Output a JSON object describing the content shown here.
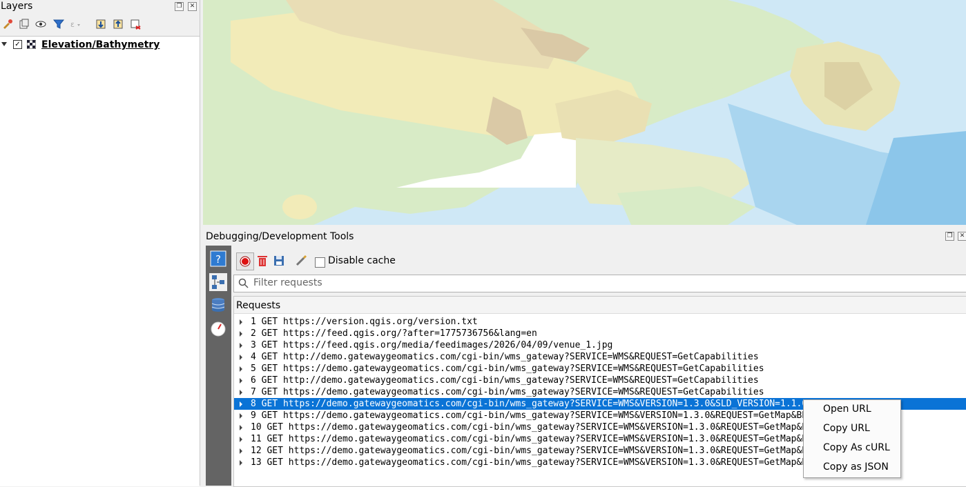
{
  "layers_panel": {
    "title": "Layers",
    "toolbar_icons": [
      "open-layer-styling-icon",
      "add-group-icon",
      "manage-map-themes-icon",
      "filter-legend-icon",
      "filter-by-expression-icon",
      "expand-all-icon",
      "collapse-all-icon",
      "remove-layer-icon"
    ],
    "layer": {
      "name": "Elevation/Bathymetry",
      "checked": true
    }
  },
  "debug_panel": {
    "title": "Debugging/Development Tools",
    "toolbar": {
      "disable_cache_label": "Disable cache"
    },
    "filter_placeholder": "Filter requests",
    "requests_header": "Requests",
    "requests": [
      "1 GET https://version.qgis.org/version.txt",
      "2 GET https://feed.qgis.org/?after=1775736756&lang=en",
      "3 GET https://feed.qgis.org/media/feedimages/2026/04/09/venue_1.jpg",
      "4 GET http://demo.gatewaygeomatics.com/cgi-bin/wms_gateway?SERVICE=WMS&REQUEST=GetCapabilities",
      "5 GET https://demo.gatewaygeomatics.com/cgi-bin/wms_gateway?SERVICE=WMS&REQUEST=GetCapabilities",
      "6 GET http://demo.gatewaygeomatics.com/cgi-bin/wms_gateway?SERVICE=WMS&REQUEST=GetCapabilities",
      "7 GET https://demo.gatewaygeomatics.com/cgi-bin/wms_gateway?SERVICE=WMS&REQUEST=GetCapabilities",
      "8 GET https://demo.gatewaygeomatics.com/cgi-bin/wms_gateway?SERVICE=WMS&VERSION=1.3.0&SLD_VERSION=1.1.0&REQUEST=G...",
      "9 GET https://demo.gatewaygeomatics.com/cgi-bin/wms_gateway?SERVICE=WMS&VERSION=1.3.0&REQUEST=GetMap&BBOX=31.8948...",
      "10 GET https://demo.gatewaygeomatics.com/cgi-bin/wms_gateway?SERVICE=WMS&VERSION=1.3.0&REQUEST=GetMap&BBOX=36.975...",
      "11 GET https://demo.gatewaygeomatics.com/cgi-bin/wms_gateway?SERVICE=WMS&VERSION=1.3.0&REQUEST=GetMap&BBOX=41.745...",
      "12 GET https://demo.gatewaygeomatics.com/cgi-bin/wms_gateway?SERVICE=WMS&VERSION=1.3.0&REQUEST=GetMap&BBOX=43.381...",
      "13 GET https://demo.gatewaygeomatics.com/cgi-bin/wms_gateway?SERVICE=WMS&VERSION=1.3.0&REQUEST=GetMap&BBOX=43.237..."
    ],
    "selected_request": "8"
  },
  "context_menu": {
    "items": [
      "Open URL",
      "Copy URL",
      "Copy As cURL",
      "Copy as JSON"
    ]
  },
  "colors": {
    "selection": "#0a73d6",
    "sidebar": "#646464",
    "water": "#cfe8f6",
    "lowland": "#d8ebc6",
    "upland": "#f2ebb8",
    "highland": "#dac9a6"
  }
}
